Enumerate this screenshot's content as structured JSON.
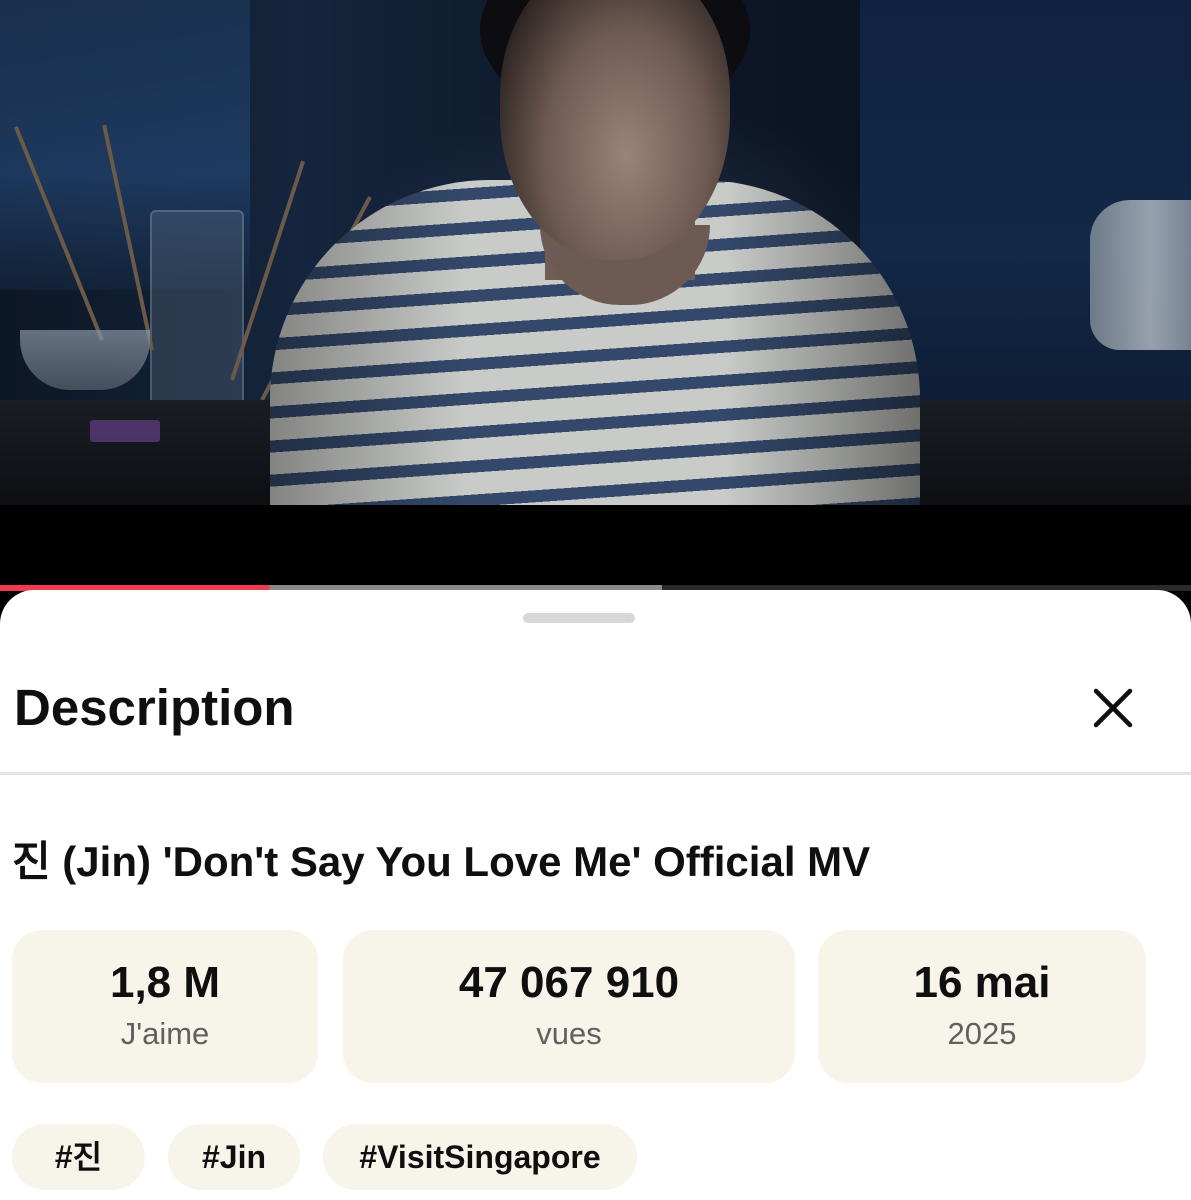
{
  "player": {
    "playback_progress": 0.226,
    "buffered_progress": 0.556,
    "colors": {
      "played": "#f03a52",
      "buffered": "#8a8a8a",
      "track": "#2a2a2a"
    }
  },
  "panel": {
    "title": "Description",
    "close_icon": "close-icon"
  },
  "video": {
    "title": "진 (Jin) 'Don't Say You Love Me' Official MV"
  },
  "stats": [
    {
      "value": "1,8 M",
      "label": "J'aime"
    },
    {
      "value": "47 067 910",
      "label": "vues"
    },
    {
      "value": "16 mai",
      "label": "2025"
    }
  ],
  "tags": [
    "#진",
    "#Jin",
    "#VisitSingapore"
  ],
  "colors": {
    "card_bg": "#f7f4e9",
    "text": "#0f0f0f",
    "muted": "#606060"
  }
}
